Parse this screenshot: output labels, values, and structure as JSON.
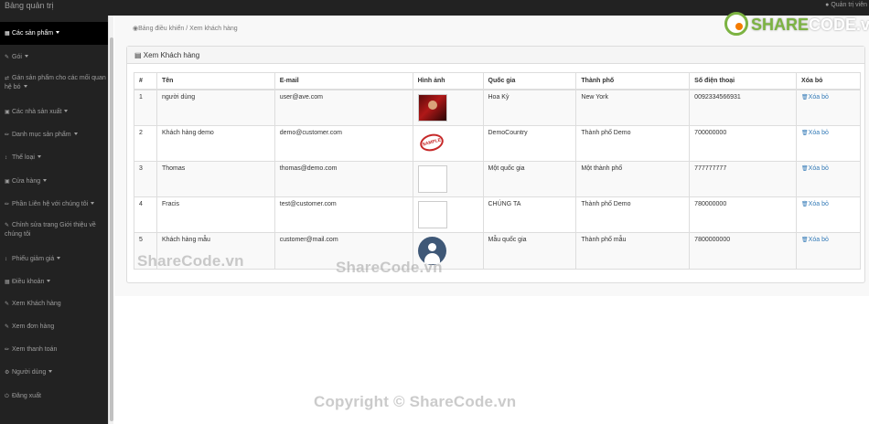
{
  "topbar": {
    "brand": "Bảng quản trị",
    "admin_icon": "user-icon",
    "admin_label": "Quản trị viên"
  },
  "sidebar": {
    "items": [
      {
        "icon": "grid-icon",
        "label": "Các sản phẩm",
        "dropdown": true,
        "active": true
      },
      {
        "icon": "edit-icon",
        "label": "Gói",
        "dropdown": true
      },
      {
        "icon": "relation-icon",
        "label": "Gán sản phẩm cho các mối quan hệ bó",
        "dropdown": true
      },
      {
        "icon": "briefcase-icon",
        "label": "Các nhà sản xuất",
        "dropdown": true
      },
      {
        "icon": "pencil-icon",
        "label": "Danh mục sản phẩm",
        "dropdown": true
      },
      {
        "icon": "resize-icon",
        "label": "Thể loại",
        "dropdown": true
      },
      {
        "icon": "briefcase-icon",
        "label": "Cửa hàng",
        "dropdown": true
      },
      {
        "icon": "pencil-icon",
        "label": "Phần Liên hệ với chúng tôi",
        "dropdown": true
      },
      {
        "icon": "edit-icon",
        "label": "Chỉnh sửa trang Giới thiệu về chúng tôi",
        "dropdown": false
      },
      {
        "icon": "resize-icon",
        "label": "Phiếu giảm giá",
        "dropdown": true
      },
      {
        "icon": "grid-icon",
        "label": "Điều khoản",
        "dropdown": true
      },
      {
        "icon": "edit-icon",
        "label": "Xem Khách hàng",
        "dropdown": false
      },
      {
        "icon": "edit-icon",
        "label": "Xem đơn hàng",
        "dropdown": false
      },
      {
        "icon": "pencil-icon",
        "label": "Xem thanh toán",
        "dropdown": false
      },
      {
        "icon": "gear-icon",
        "label": "Người dùng",
        "dropdown": true
      },
      {
        "icon": "power-icon",
        "label": "Đăng xuất",
        "dropdown": false
      }
    ]
  },
  "breadcrumb": {
    "icon": "dashboard-icon",
    "text": "Bảng điều khiển / Xem khách hàng"
  },
  "panel": {
    "icon": "money-icon",
    "title": "Xem Khách hàng"
  },
  "table": {
    "headers": [
      "#",
      "Tên",
      "E-mail",
      "Hình ảnh",
      "Quốc gia",
      "Thành phố",
      "Số điện thoại",
      "Xóa bỏ"
    ],
    "rows": [
      {
        "num": "1",
        "name": "người dùng",
        "email": "user@ave.com",
        "image": "photo",
        "country": "Hoa Kỳ",
        "city": "New York",
        "phone": "0092334566931",
        "delete": "Xóa bỏ"
      },
      {
        "num": "2",
        "name": "Khách hàng demo",
        "email": "demo@customer.com",
        "image": "sample",
        "country": "DemoCountry",
        "city": "Thành phố Demo",
        "phone": "700000000",
        "delete": "Xóa bỏ"
      },
      {
        "num": "3",
        "name": "Thomas",
        "email": "thomas@demo.com",
        "image": "broken",
        "country": "Một quốc gia",
        "city": "Một thành phố",
        "phone": "777777777",
        "delete": "Xóa bỏ"
      },
      {
        "num": "4",
        "name": "Fracis",
        "email": "test@customer.com",
        "image": "broken",
        "country": "CHÚNG TA",
        "city": "Thành phố Demo",
        "phone": "780000000",
        "delete": "Xóa bỏ"
      },
      {
        "num": "5",
        "name": "Khách hàng mẫu",
        "email": "customer@mail.com",
        "image": "avatar",
        "country": "Mẫu quốc gia",
        "city": "Thành phố mẫu",
        "phone": "7800000000",
        "delete": "Xóa bỏ"
      }
    ],
    "sample_stamp_text": "SAMPLE",
    "delete_icon": "trash-icon"
  },
  "watermarks": {
    "left": "ShareCode.vn",
    "center": "ShareCode.vn",
    "bottom": "Copyright © ShareCode.vn",
    "logo_green": "SHARE",
    "logo_rest": "CODE.vn"
  },
  "colors": {
    "topbar": "#222222",
    "sidebar": "#222222",
    "sidebar_active": "#000000",
    "link": "#337ab7",
    "logo_green": "#7cb342",
    "logo_orange": "#f57c00"
  }
}
